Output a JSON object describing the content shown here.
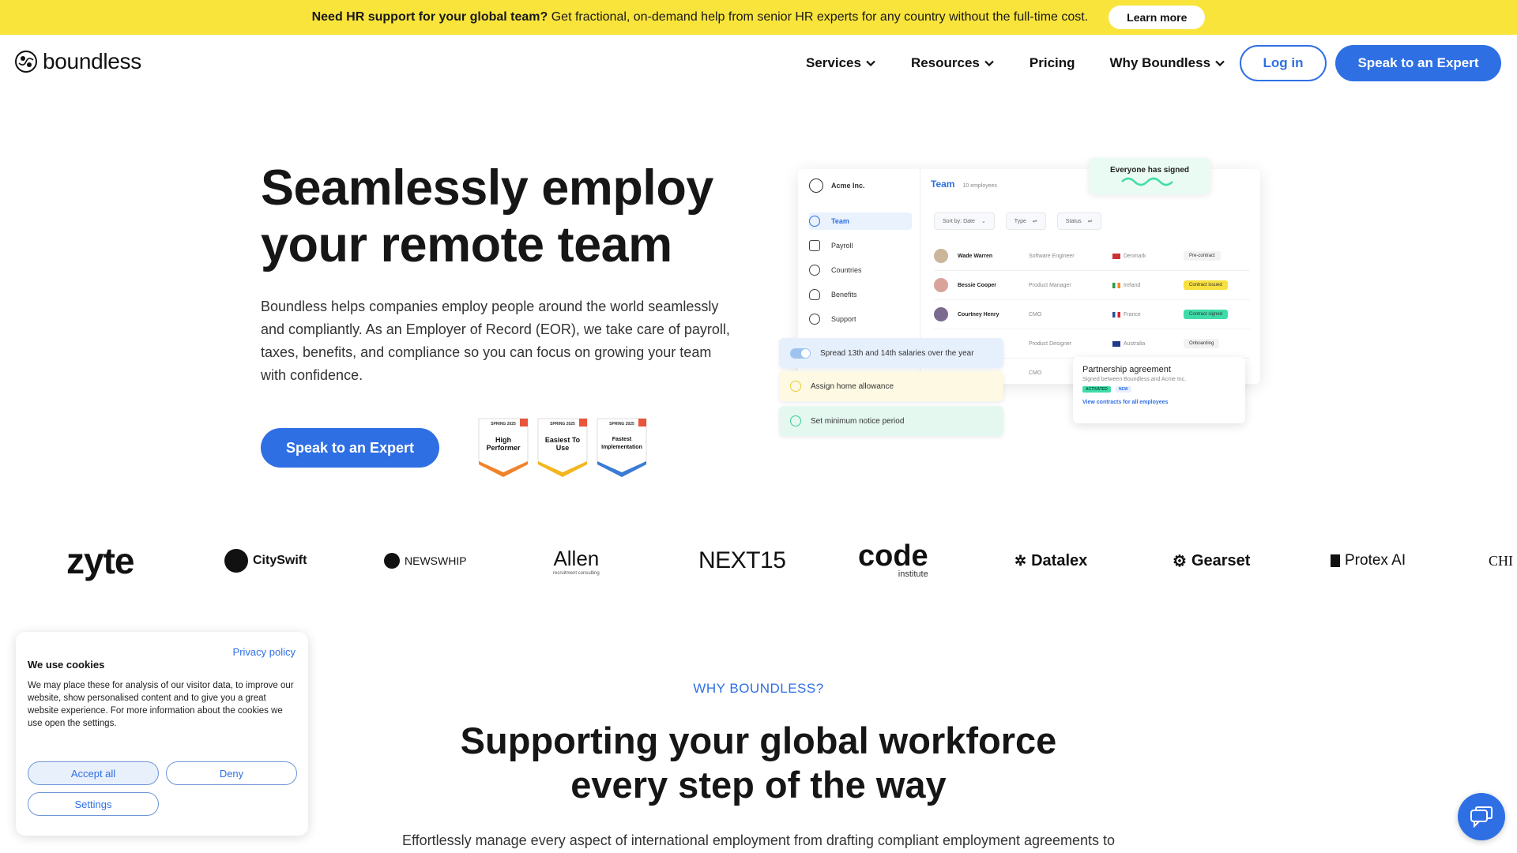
{
  "banner": {
    "bold": "Need HR support for your global team?",
    "text": "Get fractional, on-demand help from senior HR experts for any country without the full-time cost.",
    "button": "Learn more",
    "bg_color": "#f9e43c"
  },
  "nav": {
    "logo_text": "boundless",
    "items": [
      {
        "label": "Services",
        "dropdown": true
      },
      {
        "label": "Resources",
        "dropdown": true
      },
      {
        "label": "Pricing",
        "dropdown": false
      },
      {
        "label": "Why Boundless",
        "dropdown": true
      }
    ],
    "login": "Log in",
    "cta": "Speak to an Expert",
    "accent_color": "#2f6fe4"
  },
  "hero": {
    "title_line1": "Seamlessly employ",
    "title_line2": "your remote team",
    "description": "Boundless helps companies employ people around the world seamlessly and compliantly. As an Employer of Record (EOR), we take care of payroll, taxes, benefits, and compliance so you can focus on growing your team with confidence.",
    "cta": "Speak to an Expert",
    "badges": [
      {
        "season": "SPRING 2025",
        "name": "High Performer",
        "color": "#f0832a"
      },
      {
        "season": "SPRING 2025",
        "name": "Easiest To Use",
        "color": "#f3b61f"
      },
      {
        "season": "SPRING 2025",
        "name": "Fastest Implementation",
        "color": "#3a7bd5"
      }
    ]
  },
  "mockup": {
    "company": "Acme Inc.",
    "sidebar": [
      "Team",
      "Payroll",
      "Countries",
      "Benefits",
      "Support"
    ],
    "header_title": "Team",
    "header_count": "10 employees",
    "filters": [
      "Sort by: Date",
      "Type",
      "Status"
    ],
    "rows": [
      {
        "name": "Wade Warren",
        "role": "Software Engineer",
        "country": "Denmark",
        "status": "Pre-contract",
        "status_kind": "pre"
      },
      {
        "name": "Bessie Cooper",
        "role": "Product Manager",
        "country": "Ireland",
        "status": "Contract issued",
        "status_kind": "issued"
      },
      {
        "name": "Courtney Henry",
        "role": "CMO",
        "country": "France",
        "status": "Contract signed",
        "status_kind": "signed"
      },
      {
        "name": "",
        "role": "Product Designer",
        "country": "Australia",
        "status": "Onboarding",
        "status_kind": "onb"
      },
      {
        "name": "",
        "role": "CMO",
        "country": "",
        "status": "",
        "status_kind": ""
      }
    ],
    "signed_popup": "Everyone has signed",
    "tasks": [
      {
        "label": "Spread 13th and 14th salaries over the year",
        "kind": "toggle",
        "bg": "#e6f0fc",
        "color": "#9ec3ef"
      },
      {
        "label": "Assign home allowance",
        "kind": "check",
        "bg": "#fdf9e2",
        "color": "#e8cd3a"
      },
      {
        "label": "Set minimum notice period",
        "kind": "check",
        "bg": "#e4f8f0",
        "color": "#3fc99a"
      }
    ],
    "partnership": {
      "title": "Partnership agreement",
      "subtitle": "Signed between Boundless and Acme Inc.",
      "tag1": "ACTIVATED",
      "tag2": "NEW",
      "link": "View contracts for all employees"
    }
  },
  "logos": [
    "zyte",
    "CitySwift",
    "NEWSWHIP",
    "Allen",
    "NEXT15",
    "code",
    "Datalex",
    "Gearset",
    "Protex AI",
    "CHI"
  ],
  "logo_sub": {
    "allen": "recruitment consulting",
    "code": "institute"
  },
  "why": {
    "eyebrow": "WHY BOUNDLESS?",
    "title_line1": "Supporting your global workforce",
    "title_line2": "every step of the way",
    "text": "Effortlessly manage every aspect of international employment from drafting compliant employment agreements to"
  },
  "cookie": {
    "privacy": "Privacy policy",
    "title": "We use cookies",
    "text": "We may place these for analysis of our visitor data, to improve our website, show personalised content and to give you a great website experience. For more information about the cookies we use open the settings.",
    "accept": "Accept all",
    "deny": "Deny",
    "settings": "Settings"
  }
}
